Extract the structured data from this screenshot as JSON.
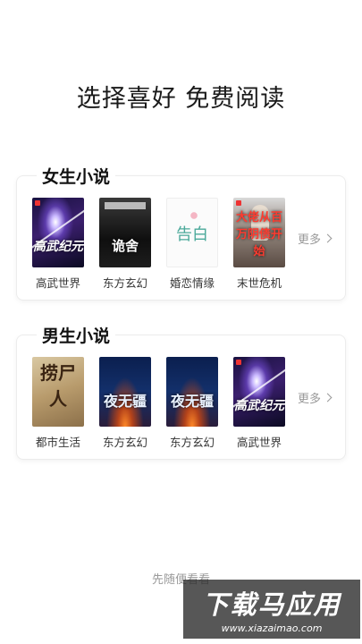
{
  "headline": "选择喜好 免费阅读",
  "sections": [
    {
      "title": "女生小说",
      "books": [
        {
          "genre": "高武世界",
          "cover_text": "高武纪元"
        },
        {
          "genre": "东方玄幻",
          "cover_text": "诡舍"
        },
        {
          "genre": "婚恋情缘",
          "cover_text": "告白"
        },
        {
          "genre": "末世危机",
          "cover_text": "大佬从百万阴债开始"
        }
      ],
      "more": "更多"
    },
    {
      "title": "男生小说",
      "books": [
        {
          "genre": "都市生活",
          "cover_text": "捞尸人"
        },
        {
          "genre": "东方玄幻",
          "cover_text": "夜无疆"
        },
        {
          "genre": "东方玄幻",
          "cover_text": "夜无疆"
        },
        {
          "genre": "高武世界",
          "cover_text": "高武纪元"
        }
      ],
      "more": "更多"
    }
  ],
  "skip": "先随便看看",
  "watermark": {
    "main": "下载马应用",
    "sub": "www.xiazaimao.com"
  },
  "icons": {
    "more": "chevron-right-icon",
    "badge": "publisher-badge-icon"
  }
}
